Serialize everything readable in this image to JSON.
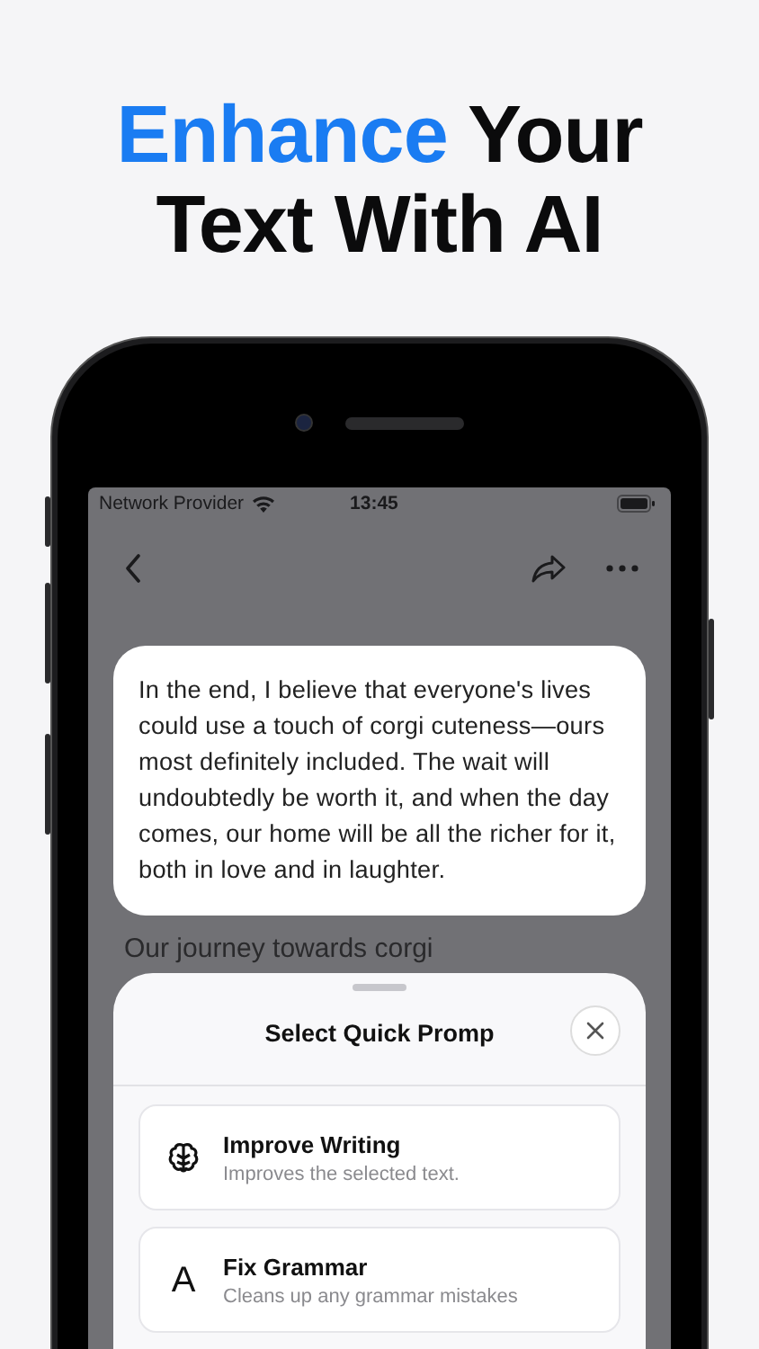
{
  "headline_lines": [
    [
      {
        "text": "Enhance",
        "accent": true
      },
      {
        "text": "Your",
        "accent": false
      }
    ],
    [
      {
        "text": "Text With AI",
        "accent": false
      }
    ]
  ],
  "status_bar": {
    "carrier": "Network Provider",
    "time": "13:45"
  },
  "document_lines": [
    "Our journey towards corgi"
  ],
  "selected_text": "In the end, I believe that everyone's lives could use a touch of corgi cuteness—ours most definitely included. The wait will undoubtedly be worth it, and when the day comes, our home will be all the richer for it, both in love and in laughter.",
  "sheet": {
    "title": "Select Quick Promp",
    "prompts": [
      {
        "kind": "brain",
        "title": "Improve Writing",
        "description": "Improves the selected text."
      },
      {
        "kind": "letter",
        "title": "Fix Grammar",
        "description": "Cleans up any grammar mistakes",
        "glyph": "A"
      }
    ]
  }
}
